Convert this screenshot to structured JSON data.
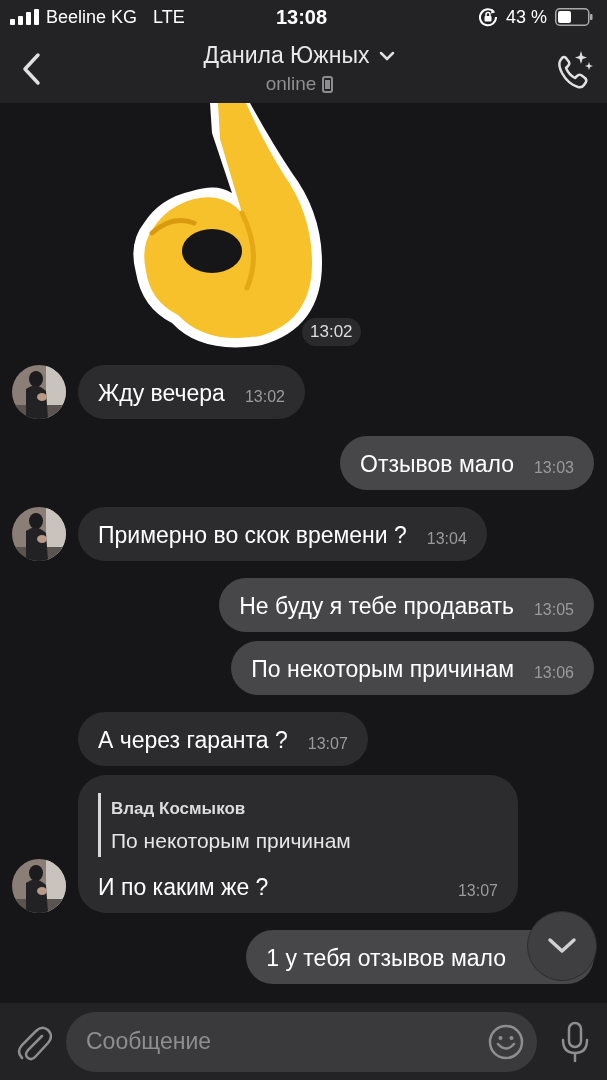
{
  "status_bar": {
    "carrier": "Beeline KG",
    "network": "LTE",
    "time": "13:08",
    "battery": "43 %"
  },
  "header": {
    "name": "Данила Южных",
    "status": "online"
  },
  "sticker": {
    "time": "13:02"
  },
  "messages": [
    {
      "kind": "incoming",
      "avatar": true,
      "text": "Жду вечера",
      "time": "13:02"
    },
    {
      "kind": "outgoing",
      "text": "Отзывов мало",
      "time": "13:03"
    },
    {
      "kind": "incoming",
      "avatar": true,
      "text": "Примерно во скок времени ?",
      "time": "13:04"
    },
    {
      "kind": "outgoing",
      "text": "Не буду я тебе продавать",
      "time": "13:05"
    },
    {
      "kind": "outgoing",
      "text": "По некоторым причинам",
      "time": "13:06"
    },
    {
      "kind": "incoming",
      "avatar": false,
      "text": "А через гаранта ?",
      "time": "13:07"
    },
    {
      "kind": "incoming",
      "avatar": true,
      "reply": {
        "author": "Влад Космыков",
        "text": "По некоторым причинам"
      },
      "text": "И по каким же ?",
      "time": "13:07"
    },
    {
      "kind": "outgoing",
      "text": "1 у тебя отзывов мало"
    }
  ],
  "composer": {
    "placeholder": "Сообщение"
  }
}
